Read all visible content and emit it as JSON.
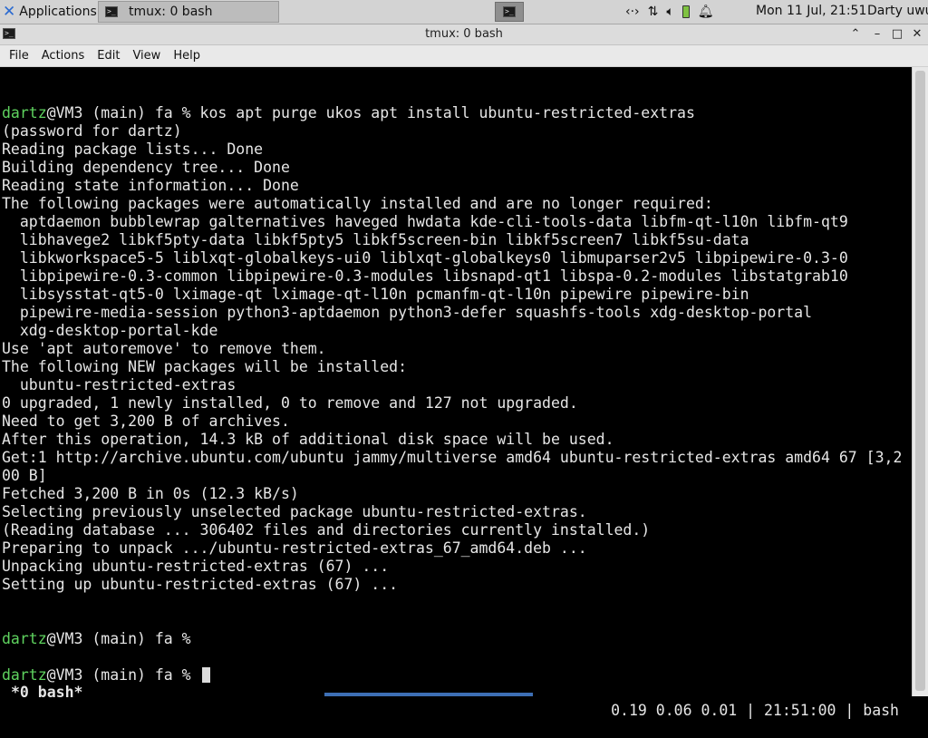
{
  "panel": {
    "apps_label": "Applications",
    "task_title": "tmux: 0 bash",
    "clock": "Mon 11 Jul, 21:51",
    "user": "Darty uwu",
    "tray_icons": [
      "network-icon",
      "transfer-icon",
      "volume-icon",
      "battery-icon",
      "notification-bell-icon"
    ]
  },
  "window": {
    "title": "tmux: 0 bash"
  },
  "menu": [
    "File",
    "Actions",
    "Edit",
    "View",
    "Help"
  ],
  "terminal": {
    "lines": [
      "",
      {
        "user": "dartz",
        "rest": "@VM3 (main) fa % kos apt purge ukos apt install ubuntu-restricted-extras"
      },
      "(password for dartz)",
      "Reading package lists... Done",
      "Building dependency tree... Done",
      "Reading state information... Done",
      "The following packages were automatically installed and are no longer required:",
      "  aptdaemon bubblewrap galternatives haveged hwdata kde-cli-tools-data libfm-qt-l10n libfm-qt9",
      "  libhavege2 libkf5pty-data libkf5pty5 libkf5screen-bin libkf5screen7 libkf5su-data",
      "  libkworkspace5-5 liblxqt-globalkeys-ui0 liblxqt-globalkeys0 libmuparser2v5 libpipewire-0.3-0",
      "  libpipewire-0.3-common libpipewire-0.3-modules libsnapd-qt1 libspa-0.2-modules libstatgrab10",
      "  libsysstat-qt5-0 lximage-qt lximage-qt-l10n pcmanfm-qt-l10n pipewire pipewire-bin",
      "  pipewire-media-session python3-aptdaemon python3-defer squashfs-tools xdg-desktop-portal",
      "  xdg-desktop-portal-kde",
      "Use 'apt autoremove' to remove them.",
      "The following NEW packages will be installed:",
      "  ubuntu-restricted-extras",
      "0 upgraded, 1 newly installed, 0 to remove and 127 not upgraded.",
      "Need to get 3,200 B of archives.",
      "After this operation, 14.3 kB of additional disk space will be used.",
      "Get:1 http://archive.ubuntu.com/ubuntu jammy/multiverse amd64 ubuntu-restricted-extras amd64 67 [3,2",
      "00 B]",
      "Fetched 3,200 B in 0s (12.3 kB/s)",
      "Selecting previously unselected package ubuntu-restricted-extras.",
      "(Reading database ... 306402 files and directories currently installed.)",
      "Preparing to unpack .../ubuntu-restricted-extras_67_amd64.deb ...",
      "Unpacking ubuntu-restricted-extras (67) ...",
      "Setting up ubuntu-restricted-extras (67) ...",
      "",
      "",
      {
        "user": "dartz",
        "rest": "@VM3 (main) fa %"
      },
      "",
      {
        "user": "dartz",
        "rest": "@VM3 (main) fa % ",
        "cursor": true
      }
    ],
    "status_left": "*0 bash*",
    "status_right": "0.19 0.06 0.01 | 21:51:00 | bash"
  },
  "colors": {
    "prompt_user": "#5fd35f",
    "terminal_bg": "#000000",
    "terminal_fg": "#e6e6e6"
  }
}
